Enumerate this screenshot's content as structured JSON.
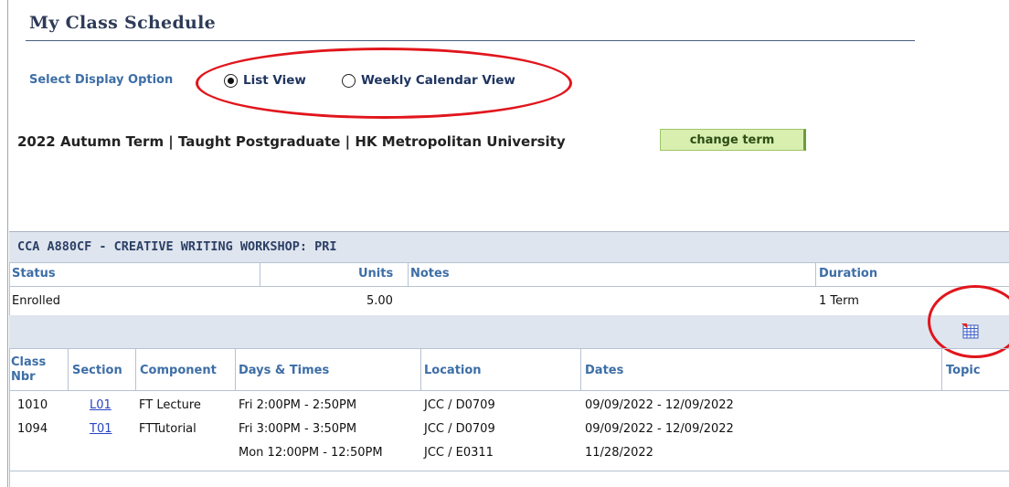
{
  "page": {
    "title": "My Class Schedule"
  },
  "display_option": {
    "label": "Select Display Option",
    "options": [
      {
        "label": "List View",
        "selected": true
      },
      {
        "label": "Weekly Calendar View",
        "selected": false
      }
    ]
  },
  "term": {
    "text": "2022 Autumn Term | Taught Postgraduate | HK Metropolitan University",
    "change_button": "change term"
  },
  "course": {
    "title": "CCA A880CF - CREATIVE WRITING WORKSHOP: PRI",
    "status_headers": {
      "status": "Status",
      "units": "Units",
      "notes": "Notes",
      "duration": "Duration"
    },
    "status_row": {
      "status": "Enrolled",
      "units": "5.00",
      "notes": "",
      "duration": "1 Term"
    },
    "calendar_icon": "add-to-calendar-icon",
    "class_headers": {
      "class_nbr_1": "Class",
      "class_nbr_2": "Nbr",
      "section": "Section",
      "component": "Component",
      "days_times": "Days & Times",
      "location": "Location",
      "dates": "Dates",
      "topic": "Topic"
    },
    "class_rows": [
      {
        "class_nbr": "1010",
        "section": "L01",
        "component": "FT Lecture",
        "days_times": "Fri 2:00PM - 2:50PM",
        "location": "JCC / D0709",
        "dates": "09/09/2022 - 12/09/2022"
      },
      {
        "class_nbr": "1094",
        "section": "T01",
        "component": "FTTutorial",
        "days_times": "Fri 3:00PM - 3:50PM",
        "location": "JCC / D0709",
        "dates": "09/09/2022 - 12/09/2022"
      },
      {
        "class_nbr": "",
        "section": "",
        "component": "",
        "days_times": "Mon 12:00PM - 12:50PM",
        "location": "JCC / E0311",
        "dates": "11/28/2022"
      }
    ]
  },
  "colors": {
    "annotation_ring": "#e1151c",
    "header_band": "#dfe5ee",
    "label_blue": "#3d6ea6",
    "button_green": "#d8efb0"
  }
}
